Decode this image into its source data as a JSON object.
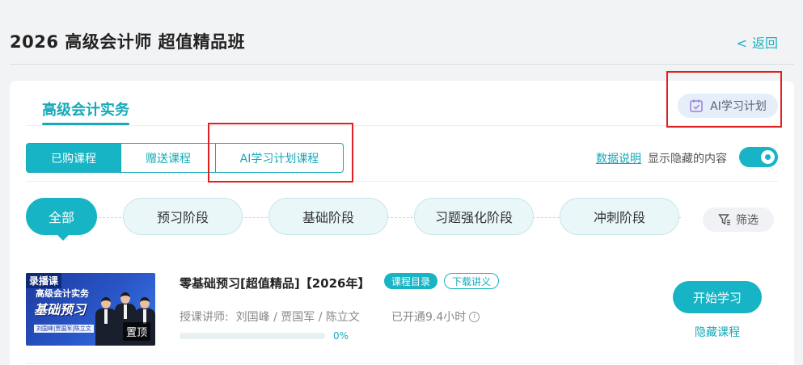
{
  "header": {
    "title": "2026 高级会计师 超值精品班",
    "back_chevron": "<",
    "back_label": "返回"
  },
  "subject_tab": {
    "label": "高级会计实务"
  },
  "ai_plan_button": {
    "label": "AI学习计划",
    "icon": "calendar-check-icon"
  },
  "course_type_tabs": [
    {
      "label": "已购课程",
      "active": true
    },
    {
      "label": "赠送课程",
      "active": false
    },
    {
      "label": "AI学习计划课程",
      "active": false
    }
  ],
  "data_explain": "数据说明",
  "show_hidden_label": "显示隐藏的内容",
  "show_hidden_toggle": {
    "on": true
  },
  "stages": [
    {
      "label": "全部",
      "active": true
    },
    {
      "label": "预习阶段",
      "active": false
    },
    {
      "label": "基础阶段",
      "active": false
    },
    {
      "label": "习题强化阶段",
      "active": false
    },
    {
      "label": "冲刺阶段",
      "active": false
    }
  ],
  "filter": {
    "label": "筛选",
    "icon": "filter-icon"
  },
  "course": {
    "thumbnail": {
      "tag": "录播课",
      "line1": "高级会计实务",
      "line2": "基础预习",
      "names": "刘国峰|贾国军|陈立文",
      "pin_label": "置顶"
    },
    "title": "零基础预习[超值精品]【2026年】",
    "badge_catalog": "课程目录",
    "badge_download": "下载讲义",
    "teachers_label": "授课讲师:",
    "teachers": "刘国峰 / 贾国军 / 陈立文",
    "opened": "已开通9.4小时",
    "progress_percent": 0,
    "progress_text": "0%",
    "start_button": "开始学习",
    "hide_link": "隐藏课程"
  },
  "colors": {
    "accent": "#16b4c4",
    "accent_text": "#16a9b9",
    "highlight_box": "#e02020"
  }
}
